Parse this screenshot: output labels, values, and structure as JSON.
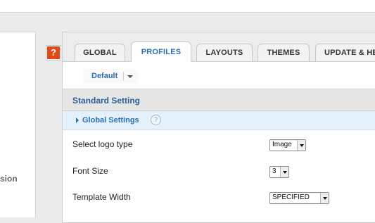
{
  "help_button": {
    "label": "?"
  },
  "left_panel": {
    "fragment": "sion"
  },
  "tabs": [
    {
      "label": "GLOBAL",
      "active": false
    },
    {
      "label": "PROFILES",
      "active": true
    },
    {
      "label": "LAYOUTS",
      "active": false
    },
    {
      "label": "THEMES",
      "active": false
    },
    {
      "label": "UPDATE & HE",
      "active": false
    }
  ],
  "profile_selector": {
    "label": "Default"
  },
  "section": {
    "title": "Standard Setting",
    "group": {
      "label": "Global Settings",
      "help": "?"
    }
  },
  "settings": [
    {
      "label": "Select logo type",
      "value": "Image"
    },
    {
      "label": "Font Size",
      "value": "3"
    },
    {
      "label": "Template Width",
      "value": "SPECIFIED"
    }
  ],
  "colors": {
    "accent": "#2a6fb3",
    "help_red": "#e34a16",
    "header_text": "#2a5f95"
  }
}
